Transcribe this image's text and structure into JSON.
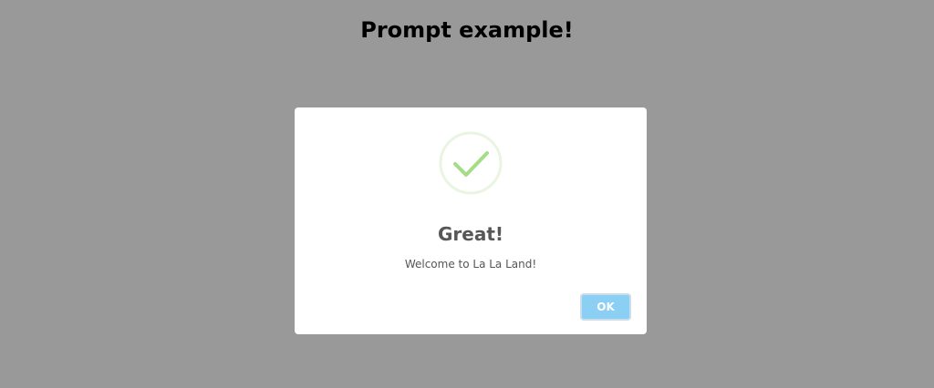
{
  "page": {
    "title": "Prompt example!"
  },
  "dialog": {
    "icon": "success-check-icon",
    "title": "Great!",
    "text": "Welcome to La La Land!",
    "confirm_label": "OK"
  },
  "colors": {
    "backdrop": "#999999",
    "dialog_background": "#ffffff",
    "check_color": "#a5dc86",
    "check_ring": "#e9f5e1",
    "button_background": "#8ccff5",
    "title_color": "#575757"
  }
}
